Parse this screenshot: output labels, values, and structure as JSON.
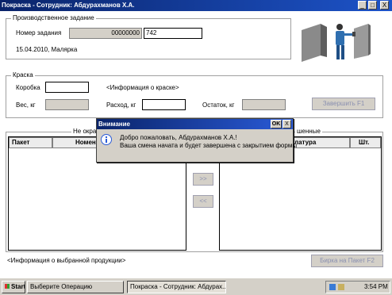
{
  "window": {
    "title": "Покраска - Сотрудник: Абдурахманов Х.А.",
    "minimize": "_",
    "maximize": "□",
    "close": "X"
  },
  "task": {
    "legend": "Производственное задание",
    "number_label": "Номер задания",
    "number_prefix": "00000000",
    "number_value": "742",
    "date_info": "15.04.2010, Малярка"
  },
  "paint": {
    "legend": "Краска",
    "box_label": "Коробка",
    "box_value": "",
    "info_label": "<Информация о краске>",
    "weight_label": "Вес, кг",
    "weight_value": "",
    "consumption_label": "Расход, кг",
    "consumption_value": "",
    "remainder_label": "Остаток, кг",
    "remainder_value": "",
    "finish_button": "Завершить    F1"
  },
  "lists": {
    "left_legend": "Не окра",
    "right_legend": "шенные",
    "left_columns": [
      "Пакет",
      "Номен"
    ],
    "right_columns": [
      "латура",
      "Шт."
    ],
    "move_right": ">>",
    "move_left": "<<"
  },
  "footer": {
    "product_info": "<Информация о выбранной продукции>",
    "tag_button": "Бирка на Пакет  F2"
  },
  "dialog": {
    "title": "Внимание",
    "ok": "OK",
    "close": "X",
    "line1": "Добро пожаловать, Абдурахманов Х.А.!",
    "line2": "Ваша смена начата и будет завершена с закрытием формы"
  },
  "taskbar": {
    "start": "Start",
    "app1": "Выберите Операцию",
    "app2": "Покраска - Сотрудник: Абдурах...",
    "clock": "3:54 PM"
  },
  "colors": {
    "titlebar": "#0a246a",
    "face": "#d4d0c8",
    "info_icon": "#2a5bd8"
  }
}
